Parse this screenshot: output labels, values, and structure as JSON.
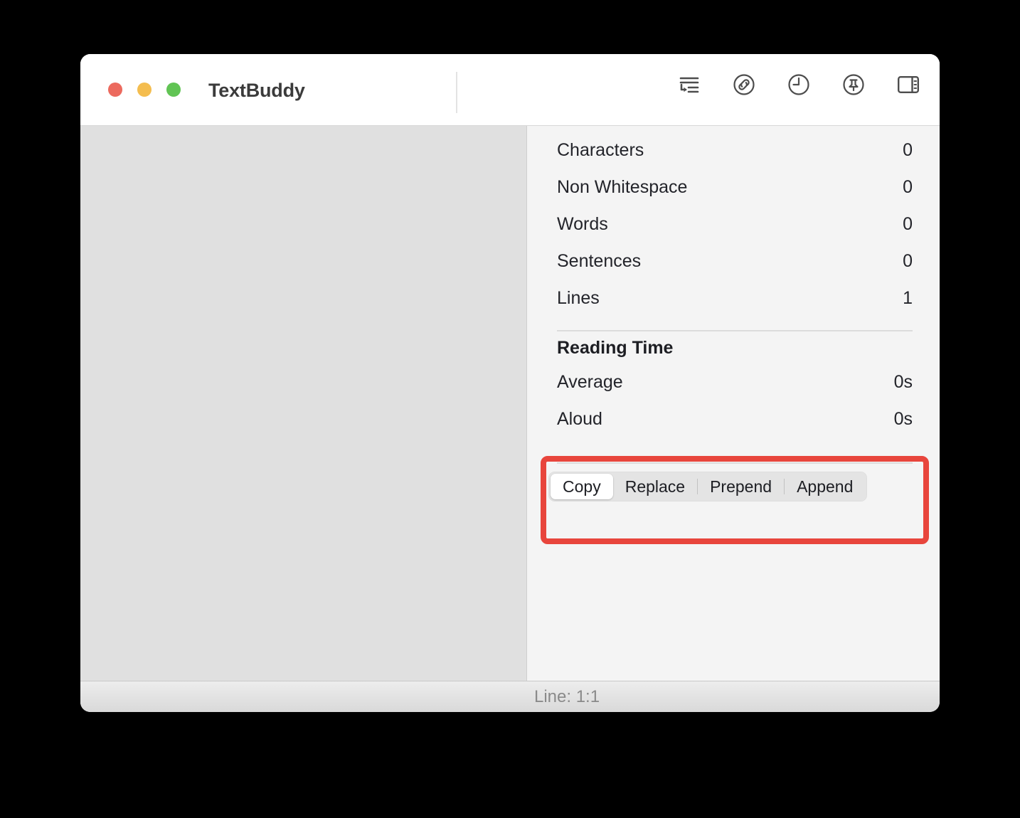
{
  "window": {
    "title": "TextBuddy",
    "traffic_lights": [
      {
        "name": "close",
        "color": "#ec6a5e"
      },
      {
        "name": "minimize",
        "color": "#f4bd4f"
      },
      {
        "name": "zoom",
        "color": "#61c454"
      }
    ]
  },
  "toolbar": {
    "items": [
      {
        "icon": "text-wrap-icon",
        "label": "Wrap Lines"
      },
      {
        "icon": "link-circle-icon",
        "label": "Links"
      },
      {
        "icon": "clock-icon",
        "label": "History"
      },
      {
        "icon": "pin-circle-icon",
        "label": "Pin"
      },
      {
        "icon": "sidebar-toggle-icon",
        "label": "Toggle Inspector"
      }
    ]
  },
  "editor": {
    "content": ""
  },
  "sidebar": {
    "stats": [
      {
        "label": "Characters",
        "value": "0"
      },
      {
        "label": "Non Whitespace",
        "value": "0"
      },
      {
        "label": "Words",
        "value": "0"
      },
      {
        "label": "Sentences",
        "value": "0"
      },
      {
        "label": "Lines",
        "value": "1"
      }
    ],
    "reading_time": {
      "heading": "Reading Time",
      "rows": [
        {
          "label": "Average",
          "value": "0s"
        },
        {
          "label": "Aloud",
          "value": "0s"
        }
      ]
    },
    "actions": {
      "selected": "Copy",
      "segments": [
        {
          "label": "Copy",
          "selected": true
        },
        {
          "label": "Replace",
          "selected": false
        },
        {
          "label": "Prepend",
          "selected": false
        },
        {
          "label": "Append",
          "selected": false
        }
      ]
    }
  },
  "status_bar": {
    "line_info": "Line: 1:1"
  },
  "annotation": {
    "type": "highlight-rectangle",
    "color": "#e8453c",
    "target": "actions-segmented-control"
  }
}
